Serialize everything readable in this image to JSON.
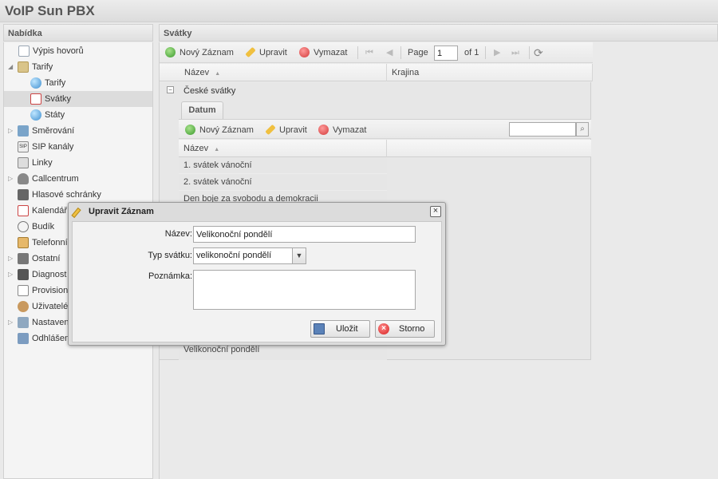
{
  "app": {
    "title": "VoIP Sun PBX"
  },
  "sidebar": {
    "title": "Nabídka",
    "items": [
      {
        "label": "Výpis hovorů",
        "icon": "document-icon"
      },
      {
        "label": "Tarify",
        "icon": "folder-icon"
      },
      {
        "label": "Tarify",
        "icon": "globe-icon"
      },
      {
        "label": "Svátky",
        "icon": "calendar-icon"
      },
      {
        "label": "Státy",
        "icon": "globe-icon"
      },
      {
        "label": "Směrování",
        "icon": "routing-icon"
      },
      {
        "label": "SIP kanály",
        "icon": "sip-icon"
      },
      {
        "label": "Linky",
        "icon": "line-icon"
      },
      {
        "label": "Callcentrum",
        "icon": "headset-icon"
      },
      {
        "label": "Hlasové schránky",
        "icon": "voicemail-icon"
      },
      {
        "label": "Kalendář",
        "icon": "calendar-icon"
      },
      {
        "label": "Budík",
        "icon": "clock-icon"
      },
      {
        "label": "Telefonní",
        "icon": "phonebook-icon"
      },
      {
        "label": "Ostatní",
        "icon": "misc-icon"
      },
      {
        "label": "Diagnost",
        "icon": "diagnostics-icon"
      },
      {
        "label": "Provision",
        "icon": "provision-icon"
      },
      {
        "label": "Uživatelé",
        "icon": "users-icon"
      },
      {
        "label": "Nastaven",
        "icon": "wrench-icon"
      },
      {
        "label": "Odhlášen",
        "icon": "logout-icon"
      }
    ]
  },
  "main": {
    "title": "Svátky",
    "toolbar": {
      "new_label": "Nový Záznam",
      "edit_label": "Upravit",
      "delete_label": "Vymazat",
      "page_label": "Page",
      "page_value": "1",
      "of_label": "of 1"
    },
    "columns": [
      "Název",
      "Krajina"
    ],
    "group": {
      "label": "České svátky"
    },
    "subtab": {
      "label": "Datum"
    },
    "sub_toolbar": {
      "new_label": "Nový Záznam",
      "edit_label": "Upravit",
      "delete_label": "Vymazat",
      "search_placeholder": ""
    },
    "sub_columns": [
      "Název"
    ],
    "rows": [
      "1. svátek vánoční",
      "2. svátek vánoční",
      "Den boje za svobodu a demokracii",
      "Velikonoční pondělí"
    ]
  },
  "dialog": {
    "title": "Upravit Záznam",
    "fields": {
      "name_label": "Název:",
      "name_value": "Velikonoční pondělí",
      "type_label": "Typ svátku:",
      "type_value": "velikonoční pondělí",
      "note_label": "Poznámka:",
      "note_value": ""
    },
    "save_label": "Uložit",
    "cancel_label": "Storno"
  }
}
